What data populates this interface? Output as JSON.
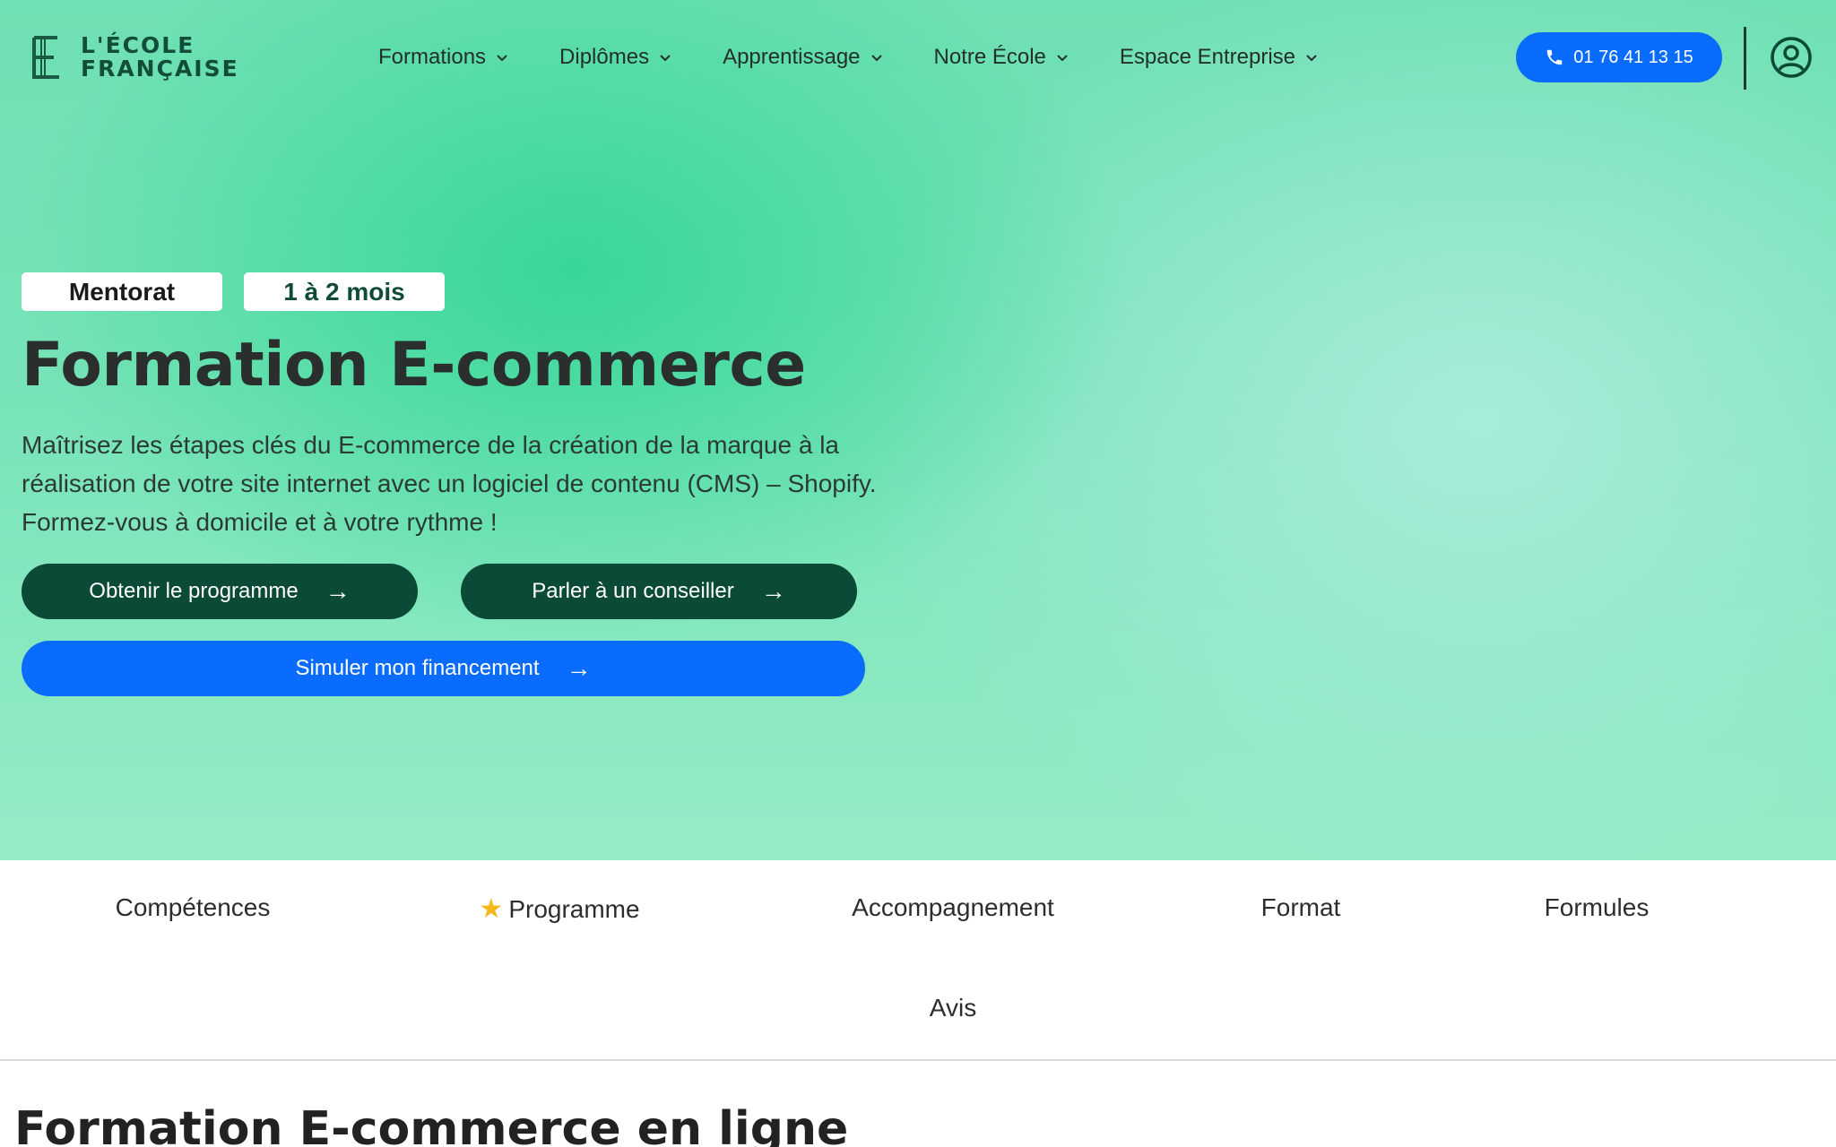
{
  "header": {
    "logo": {
      "line1": "L'ÉCOLE",
      "line2": "FRANÇAISE",
      "icon": "ef-monogram"
    },
    "nav": [
      {
        "label": "Formations"
      },
      {
        "label": "Diplômes"
      },
      {
        "label": "Apprentissage"
      },
      {
        "label": "Notre École"
      },
      {
        "label": "Espace Entreprise"
      }
    ],
    "phone": {
      "label": "01 76 41 13 15",
      "icon": "phone-icon"
    },
    "account_icon": "user-circle-icon"
  },
  "hero": {
    "badges": [
      "Mentorat",
      "1 à 2 mois"
    ],
    "title": "Formation E-commerce",
    "description": "Maîtrisez les étapes clés du E-commerce de la création de la marque à la réalisation de votre site internet avec un logiciel de contenu (CMS) – Shopify. Formez-vous à domicile et à votre rythme !",
    "buttons": {
      "program": "Obtenir le programme",
      "advisor": "Parler à un conseiller",
      "financing": "Simuler mon financement"
    },
    "arrow": "→"
  },
  "tabs": [
    "Compétences",
    "Programme",
    "Accompagnement",
    "Format",
    "Formules",
    "Avis"
  ],
  "section": {
    "title": "Formation E-commerce en ligne"
  },
  "colors": {
    "accent_blue": "#0a6cff",
    "dark_green": "#0b4a36",
    "hero_green": "#6fe0b3"
  }
}
